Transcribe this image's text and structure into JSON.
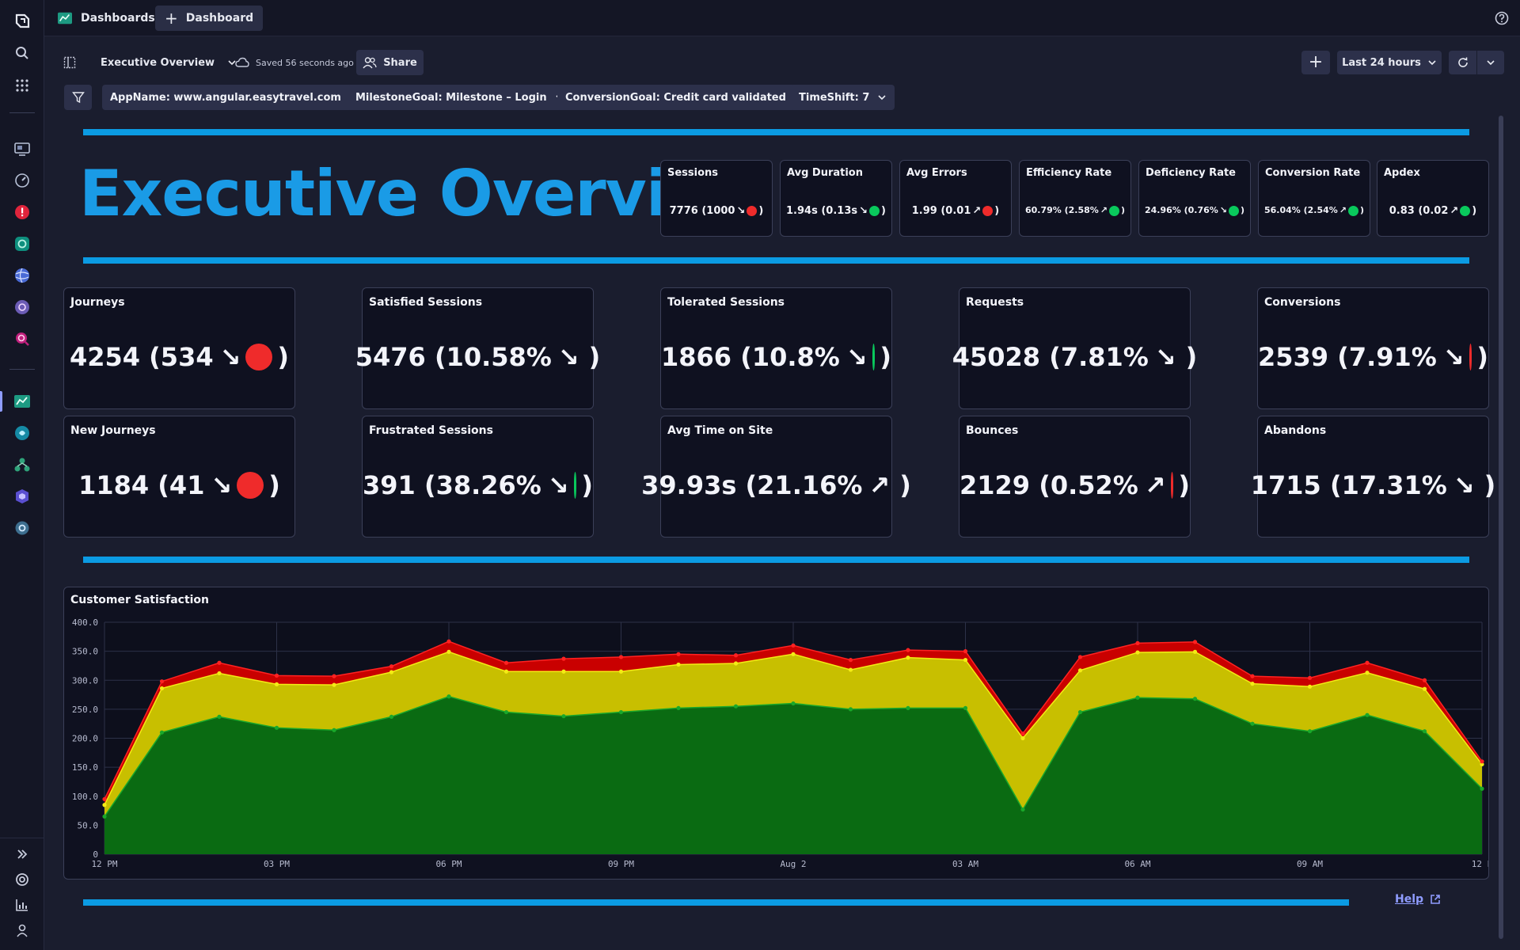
{
  "topbar": {
    "app_label": "Dashboards",
    "new_tab_label": "Dashboard"
  },
  "toolbar": {
    "dashboard_name": "Executive Overview",
    "saved_status": "Saved 56 seconds ago",
    "share_label": "Share",
    "timeframe": "Last 24 hours"
  },
  "filters": [
    {
      "label": "AppName: www.angular.easytravel.com"
    },
    {
      "label": "MilestoneGoal: Milestone – Login"
    },
    {
      "label": "ConversionGoal: Credit card validated"
    },
    {
      "label": "TimeShift: 7"
    }
  ],
  "header": {
    "title": "Executive Overview"
  },
  "kpis_small": [
    {
      "title": "Sessions",
      "value": "7776 (1000",
      "arrow": "↘",
      "status": "red"
    },
    {
      "title": "Avg Duration",
      "value": "1.94s (0.13s",
      "arrow": "↘",
      "status": "green"
    },
    {
      "title": "Avg Errors",
      "value": "1.99 (0.01",
      "arrow": "↗",
      "status": "red"
    },
    {
      "title": "Efficiency Rate",
      "value": "60.79% (2.58%",
      "arrow": "↗",
      "status": "green"
    },
    {
      "title": "Deficiency Rate",
      "value": "24.96% (0.76%",
      "arrow": "↘",
      "status": "green"
    },
    {
      "title": "Conversion Rate",
      "value": "56.04% (2.54%",
      "arrow": "↗",
      "status": "green"
    },
    {
      "title": "Apdex",
      "value": "0.83 (0.02",
      "arrow": "↗",
      "status": "green"
    }
  ],
  "kpis_large": [
    {
      "title": "Journeys",
      "value": "4254 (534",
      "arrow": "↘",
      "status": "red"
    },
    {
      "title": "Satisfied Sessions",
      "value": "5476 (10.58%",
      "arrow": "↘",
      "status": "red"
    },
    {
      "title": "Tolerated Sessions",
      "value": "1866 (10.8%",
      "arrow": "↘",
      "status": "green"
    },
    {
      "title": "Requests",
      "value": "45028 (7.81%",
      "arrow": "↘",
      "status": "red"
    },
    {
      "title": "Conversions",
      "value": "2539 (7.91%",
      "arrow": "↘",
      "status": "red"
    },
    {
      "title": "New Journeys",
      "value": "1184 (41",
      "arrow": "↘",
      "status": "red"
    },
    {
      "title": "Frustrated Sessions",
      "value": "391 (38.26%",
      "arrow": "↘",
      "status": "green"
    },
    {
      "title": "Avg Time on Site",
      "value": "39.93s (21.16%",
      "arrow": "↗",
      "status": "red"
    },
    {
      "title": "Bounces",
      "value": "2129 (0.52%",
      "arrow": "↗",
      "status": "red"
    },
    {
      "title": "Abandons",
      "value": "1715 (17.31%",
      "arrow": "↘",
      "status": "green"
    }
  ],
  "colors": {
    "accent_blue": "#0b9be3",
    "status_red": "#ef2b2b",
    "status_green": "#09c95c",
    "satisfied": "#0a6b12",
    "tolerated": "#c8bf00",
    "frustrated": "#c90000"
  },
  "chart_data": {
    "type": "area",
    "title": "Customer Satisfaction",
    "ylim": [
      0,
      400
    ],
    "yticks": [
      "0",
      "50.0",
      "100.0",
      "150.0",
      "200.0",
      "250.0",
      "300.0",
      "350.0",
      "400.0"
    ],
    "xticks": [
      "12 PM",
      "03 PM",
      "06 PM",
      "09 PM",
      "Aug 2",
      "03 AM",
      "06 AM",
      "09 AM",
      "12 P"
    ],
    "grid": true,
    "stacked": true,
    "series": [
      {
        "color": "#0a6b12",
        "values": [
          65,
          210,
          237,
          218,
          214,
          237,
          272,
          245,
          238,
          245,
          252,
          255,
          260,
          250,
          252,
          252,
          77,
          245,
          270,
          268,
          225,
          212,
          240,
          212,
          113
        ]
      },
      {
        "color": "#c8bf00",
        "values": [
          20,
          76,
          75,
          75,
          78,
          77,
          77,
          70,
          77,
          70,
          75,
          74,
          85,
          68,
          87,
          83,
          123,
          72,
          78,
          81,
          69,
          77,
          73,
          73,
          42
        ]
      },
      {
        "color": "#c90000",
        "values": [
          10,
          12,
          18,
          15,
          15,
          10,
          18,
          15,
          22,
          25,
          18,
          14,
          15,
          17,
          13,
          15,
          8,
          23,
          16,
          17,
          13,
          15,
          17,
          15,
          5
        ]
      }
    ]
  },
  "footer": {
    "help_label": "Help"
  }
}
